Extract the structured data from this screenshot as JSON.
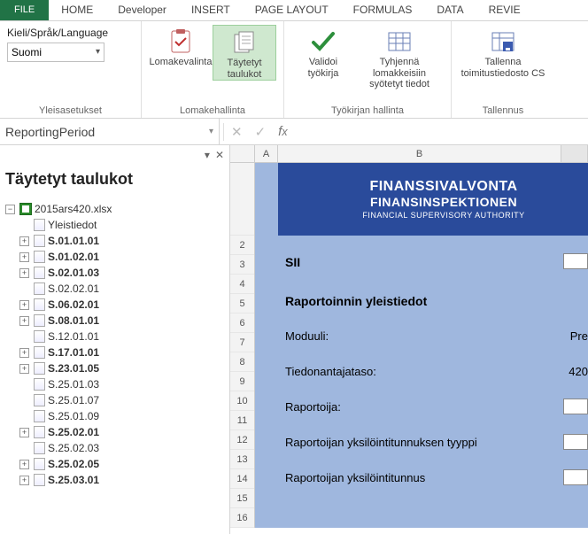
{
  "ribbon_tabs": {
    "file": "FILE",
    "home": "HOME",
    "developer": "Developer",
    "insert": "INSERT",
    "page_layout": "PAGE LAYOUT",
    "formulas": "FORMULAS",
    "data": "DATA",
    "review": "REVIE"
  },
  "ribbon": {
    "lang": {
      "label": "Kieli/Språk/Language",
      "value": "Suomi",
      "group_label": "Yleisasetukset"
    },
    "form": {
      "lomakevalinta": "Lomakevalinta",
      "taytetyt": "Täytetyt\ntaulukot",
      "group_label": "Lomakehallinta"
    },
    "workbook": {
      "validoi": "Validoi\ntyökirja",
      "tyhjenna": "Tyhjennä lomakkeisiin\nsyötetyt tiedot",
      "group_label": "Työkirjan hallinta"
    },
    "save": {
      "tallenna": "Tallenna\ntoimitustiedosto CS",
      "group_label": "Tallennus"
    }
  },
  "namebox": "ReportingPeriod",
  "leftpane": {
    "title": "Täytetyt taulukot",
    "root": "2015ars420.xlsx",
    "items": [
      {
        "label": "Yleistiedot",
        "bold": false,
        "expand": ""
      },
      {
        "label": "S.01.01.01",
        "bold": true,
        "expand": "+"
      },
      {
        "label": "S.01.02.01",
        "bold": true,
        "expand": "+"
      },
      {
        "label": "S.02.01.03",
        "bold": true,
        "expand": "+"
      },
      {
        "label": "S.02.02.01",
        "bold": false,
        "expand": ""
      },
      {
        "label": "S.06.02.01",
        "bold": true,
        "expand": "+"
      },
      {
        "label": "S.08.01.01",
        "bold": true,
        "expand": "+"
      },
      {
        "label": "S.12.01.01",
        "bold": false,
        "expand": ""
      },
      {
        "label": "S.17.01.01",
        "bold": true,
        "expand": "+"
      },
      {
        "label": "S.23.01.05",
        "bold": true,
        "expand": "+"
      },
      {
        "label": "S.25.01.03",
        "bold": false,
        "expand": ""
      },
      {
        "label": "S.25.01.07",
        "bold": false,
        "expand": ""
      },
      {
        "label": "S.25.01.09",
        "bold": false,
        "expand": ""
      },
      {
        "label": "S.25.02.01",
        "bold": true,
        "expand": "+"
      },
      {
        "label": "S.25.02.03",
        "bold": false,
        "expand": ""
      },
      {
        "label": "S.25.02.05",
        "bold": true,
        "expand": "+"
      },
      {
        "label": "S.25.03.01",
        "bold": true,
        "expand": "+"
      }
    ]
  },
  "grid": {
    "colA": "A",
    "colB": "B",
    "brand": {
      "l1": "FINANSSIVALVONTA",
      "l2": "FINANSINSPEKTIONEN",
      "l3": "FINANCIAL SUPERVISORY AUTHORITY"
    },
    "sii": "SII",
    "heading": "Raportoinnin yleistiedot",
    "rows": [
      {
        "label": "Moduuli:",
        "value": "Pre"
      },
      {
        "label": "Tiedonantajataso:",
        "value": "420"
      },
      {
        "label": "Raportoija:",
        "value": ""
      },
      {
        "label": "Raportoijan yksilöintitunnuksen tyyppi",
        "value": ""
      },
      {
        "label": "Raportoijan yksilöintitunnus",
        "value": ""
      }
    ]
  }
}
